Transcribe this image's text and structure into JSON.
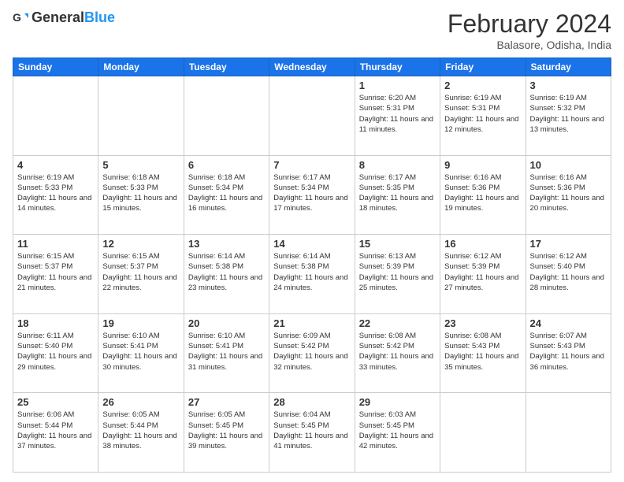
{
  "header": {
    "logo_general": "General",
    "logo_blue": "Blue",
    "month_year": "February 2024",
    "location": "Balasore, Odisha, India"
  },
  "weekdays": [
    "Sunday",
    "Monday",
    "Tuesday",
    "Wednesday",
    "Thursday",
    "Friday",
    "Saturday"
  ],
  "weeks": [
    [
      {
        "day": "",
        "info": ""
      },
      {
        "day": "",
        "info": ""
      },
      {
        "day": "",
        "info": ""
      },
      {
        "day": "",
        "info": ""
      },
      {
        "day": "1",
        "info": "Sunrise: 6:20 AM\nSunset: 5:31 PM\nDaylight: 11 hours and 11 minutes."
      },
      {
        "day": "2",
        "info": "Sunrise: 6:19 AM\nSunset: 5:31 PM\nDaylight: 11 hours and 12 minutes."
      },
      {
        "day": "3",
        "info": "Sunrise: 6:19 AM\nSunset: 5:32 PM\nDaylight: 11 hours and 13 minutes."
      }
    ],
    [
      {
        "day": "4",
        "info": "Sunrise: 6:19 AM\nSunset: 5:33 PM\nDaylight: 11 hours and 14 minutes."
      },
      {
        "day": "5",
        "info": "Sunrise: 6:18 AM\nSunset: 5:33 PM\nDaylight: 11 hours and 15 minutes."
      },
      {
        "day": "6",
        "info": "Sunrise: 6:18 AM\nSunset: 5:34 PM\nDaylight: 11 hours and 16 minutes."
      },
      {
        "day": "7",
        "info": "Sunrise: 6:17 AM\nSunset: 5:34 PM\nDaylight: 11 hours and 17 minutes."
      },
      {
        "day": "8",
        "info": "Sunrise: 6:17 AM\nSunset: 5:35 PM\nDaylight: 11 hours and 18 minutes."
      },
      {
        "day": "9",
        "info": "Sunrise: 6:16 AM\nSunset: 5:36 PM\nDaylight: 11 hours and 19 minutes."
      },
      {
        "day": "10",
        "info": "Sunrise: 6:16 AM\nSunset: 5:36 PM\nDaylight: 11 hours and 20 minutes."
      }
    ],
    [
      {
        "day": "11",
        "info": "Sunrise: 6:15 AM\nSunset: 5:37 PM\nDaylight: 11 hours and 21 minutes."
      },
      {
        "day": "12",
        "info": "Sunrise: 6:15 AM\nSunset: 5:37 PM\nDaylight: 11 hours and 22 minutes."
      },
      {
        "day": "13",
        "info": "Sunrise: 6:14 AM\nSunset: 5:38 PM\nDaylight: 11 hours and 23 minutes."
      },
      {
        "day": "14",
        "info": "Sunrise: 6:14 AM\nSunset: 5:38 PM\nDaylight: 11 hours and 24 minutes."
      },
      {
        "day": "15",
        "info": "Sunrise: 6:13 AM\nSunset: 5:39 PM\nDaylight: 11 hours and 25 minutes."
      },
      {
        "day": "16",
        "info": "Sunrise: 6:12 AM\nSunset: 5:39 PM\nDaylight: 11 hours and 27 minutes."
      },
      {
        "day": "17",
        "info": "Sunrise: 6:12 AM\nSunset: 5:40 PM\nDaylight: 11 hours and 28 minutes."
      }
    ],
    [
      {
        "day": "18",
        "info": "Sunrise: 6:11 AM\nSunset: 5:40 PM\nDaylight: 11 hours and 29 minutes."
      },
      {
        "day": "19",
        "info": "Sunrise: 6:10 AM\nSunset: 5:41 PM\nDaylight: 11 hours and 30 minutes."
      },
      {
        "day": "20",
        "info": "Sunrise: 6:10 AM\nSunset: 5:41 PM\nDaylight: 11 hours and 31 minutes."
      },
      {
        "day": "21",
        "info": "Sunrise: 6:09 AM\nSunset: 5:42 PM\nDaylight: 11 hours and 32 minutes."
      },
      {
        "day": "22",
        "info": "Sunrise: 6:08 AM\nSunset: 5:42 PM\nDaylight: 11 hours and 33 minutes."
      },
      {
        "day": "23",
        "info": "Sunrise: 6:08 AM\nSunset: 5:43 PM\nDaylight: 11 hours and 35 minutes."
      },
      {
        "day": "24",
        "info": "Sunrise: 6:07 AM\nSunset: 5:43 PM\nDaylight: 11 hours and 36 minutes."
      }
    ],
    [
      {
        "day": "25",
        "info": "Sunrise: 6:06 AM\nSunset: 5:44 PM\nDaylight: 11 hours and 37 minutes."
      },
      {
        "day": "26",
        "info": "Sunrise: 6:05 AM\nSunset: 5:44 PM\nDaylight: 11 hours and 38 minutes."
      },
      {
        "day": "27",
        "info": "Sunrise: 6:05 AM\nSunset: 5:45 PM\nDaylight: 11 hours and 39 minutes."
      },
      {
        "day": "28",
        "info": "Sunrise: 6:04 AM\nSunset: 5:45 PM\nDaylight: 11 hours and 41 minutes."
      },
      {
        "day": "29",
        "info": "Sunrise: 6:03 AM\nSunset: 5:45 PM\nDaylight: 11 hours and 42 minutes."
      },
      {
        "day": "",
        "info": ""
      },
      {
        "day": "",
        "info": ""
      }
    ]
  ]
}
